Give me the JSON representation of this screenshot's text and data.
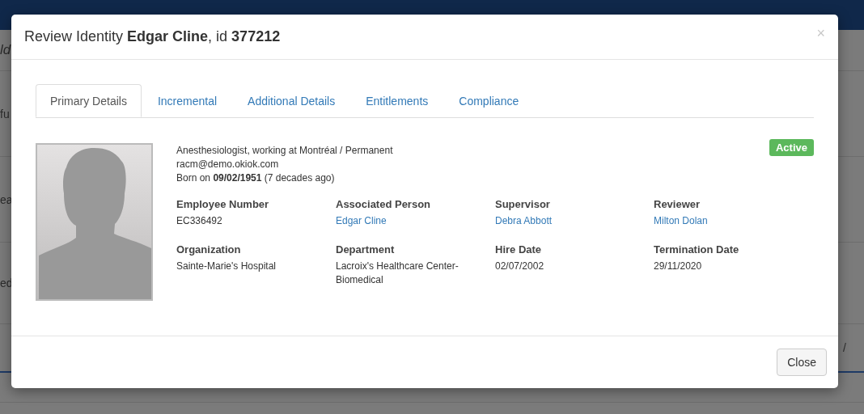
{
  "background": {
    "left_fragments": [
      "ld",
      "fu",
      "ea",
      "ed"
    ],
    "right_fragment": "/"
  },
  "modal": {
    "title": "Review Identity **Edgar Cline**, id **377212**",
    "close_symbol": "×",
    "tabs": [
      {
        "label": "Primary Details",
        "selected": true
      },
      {
        "label": "Incremental",
        "selected": false
      },
      {
        "label": "Additional Details",
        "selected": false
      },
      {
        "label": "Entitlements",
        "selected": false
      },
      {
        "label": "Compliance",
        "selected": false
      }
    ],
    "summary": [
      "Anesthesiologist, working at Montréal / Permanent",
      "racm@demo.okiok.com",
      "Born on **09/02/1951** (7 decades ago)"
    ],
    "status": {
      "label": "Active",
      "kind": "success"
    },
    "fields": [
      {
        "label": "Employee Number",
        "value": "EC336492",
        "link": false
      },
      {
        "label": "Associated Person",
        "value": "Edgar Cline",
        "link": true
      },
      {
        "label": "Supervisor",
        "value": "Debra Abbott",
        "link": true
      },
      {
        "label": "Reviewer",
        "value": "Milton Dolan",
        "link": true
      },
      {
        "label": "Organization",
        "value": "Sainte-Marie's Hospital",
        "link": false
      },
      {
        "label": "Department",
        "value": "Lacroix's Healthcare Center-Biomedical",
        "link": false
      },
      {
        "label": "Hire Date",
        "value": "02/07/2002",
        "link": false
      },
      {
        "label": "Termination Date",
        "value": "29/11/2020",
        "link": false
      }
    ],
    "footer_button": "Close"
  }
}
